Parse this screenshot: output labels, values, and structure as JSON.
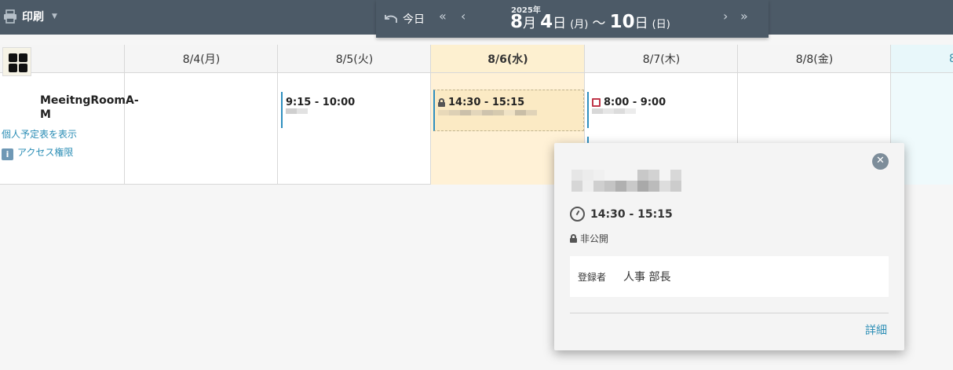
{
  "toolbar": {
    "print_label": "印刷",
    "print_icon": "printer-icon"
  },
  "nav": {
    "today_label": "今日",
    "year": "2025年",
    "start_month": "8",
    "month_unit": "月",
    "start_day": "4",
    "day_unit": "日",
    "start_weekday": "(月)",
    "tilde": "～",
    "end_day": "10",
    "end_weekday": "(日)"
  },
  "columns": [
    "8/4(月)",
    "8/5(火)",
    "8/6(水)",
    "8/7(木)",
    "8/8(金)",
    "8"
  ],
  "resource": {
    "name": "MeeitngRoomA-M",
    "link_schedule": "個人予定表を表示",
    "link_access": "アクセス権限"
  },
  "events": {
    "tue": "9:15 - 10:00",
    "wed": "14:30 - 15:15",
    "thu": "8:00 - 9:00"
  },
  "popup": {
    "time": "14:30 - 15:15",
    "visibility": "非公開",
    "registrant_label": "登録者",
    "registrant_value": "人事 部長",
    "detail_link": "詳細"
  },
  "colors": {
    "accent": "#2a8db5",
    "topbar": "#4c5a67",
    "today": "#fff1d6"
  }
}
